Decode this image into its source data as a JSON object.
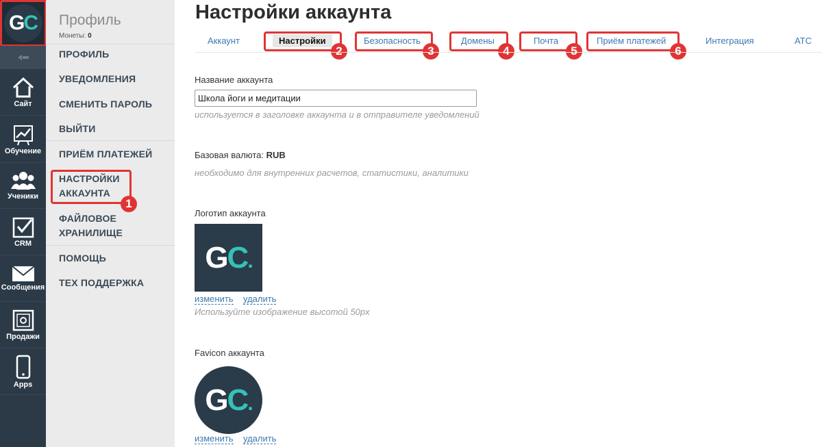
{
  "rail": {
    "logo": {
      "g": "G",
      "c": "C"
    },
    "items": [
      {
        "label": "Сайт",
        "icon": "home-icon"
      },
      {
        "label": "Обучение",
        "icon": "chart-icon"
      },
      {
        "label": "Ученики",
        "icon": "users-icon"
      },
      {
        "label": "CRM",
        "icon": "checkbox-icon"
      },
      {
        "label": "Сообщения",
        "icon": "envelope-icon"
      },
      {
        "label": "Продажи",
        "icon": "safe-icon"
      },
      {
        "label": "Apps",
        "icon": "phone-icon"
      }
    ]
  },
  "sidebar": {
    "title": "Профиль",
    "coins_label": "Монеты:",
    "coins_value": "0",
    "items": [
      "ПРОФИЛЬ",
      "УВЕДОМЛЕНИЯ",
      "СМЕНИТЬ ПАРОЛЬ",
      "ВЫЙТИ",
      "ПРИЁМ ПЛАТЕЖЕЙ",
      "НАСТРОЙКИ",
      "АККАУНТА",
      "ФАЙЛОВОЕ",
      "ХРАНИЛИЩЕ",
      "ПОМОЩЬ",
      "ТЕХ ПОДДЕРЖКА"
    ]
  },
  "main": {
    "title": "Настройки аккаунта",
    "tabs": [
      "Аккаунт",
      "Настройки",
      "Безопасность",
      "Домены",
      "Почта",
      "Приём платежей",
      "Интеграция",
      "АТС"
    ],
    "account_name_label": "Название аккаунта",
    "account_name_value": "Школа йоги и медитации",
    "account_name_hint": "используется в заголовке аккаунта и в отправителе уведомлений",
    "currency_label": "Базовая валюта:",
    "currency_value": "RUB",
    "currency_hint": "необходимо для внутренних расчетов, статистики, аналитики",
    "logo_label": "Логотип аккаунта",
    "logo_change": "изменить",
    "logo_delete": "удалить",
    "logo_hint": "Используйте изображение высотой 50px",
    "favicon_label": "Favicon аккаунта",
    "favicon_change": "изменить",
    "favicon_delete": "удалить",
    "logo_text": {
      "g": "G",
      "c": "C",
      "dot": "."
    }
  },
  "annotations": [
    "1",
    "2",
    "3",
    "4",
    "5",
    "6"
  ],
  "colors": {
    "highlight": "#e03434",
    "accent": "#35c2b4",
    "link": "#3d78b0",
    "rail": "#2c3a47"
  }
}
